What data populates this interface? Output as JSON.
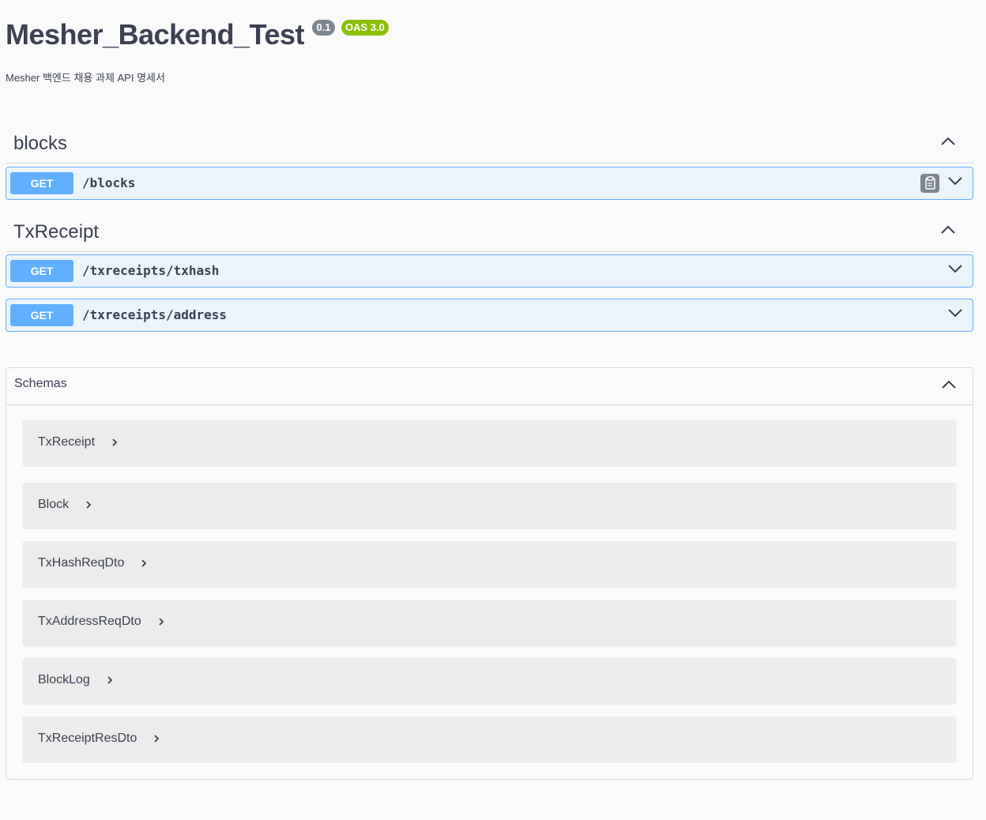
{
  "info": {
    "title": "Mesher_Backend_Test",
    "version": "0.1",
    "oas": "OAS 3.0",
    "description": "Mesher 백엔드 채용 과제 API 명세서"
  },
  "tags": [
    {
      "name": "blocks",
      "operations": [
        {
          "method": "GET",
          "path": "/blocks"
        }
      ]
    },
    {
      "name": "TxReceipt",
      "operations": [
        {
          "method": "GET",
          "path": "/txreceipts/txhash"
        },
        {
          "method": "GET",
          "path": "/txreceipts/address"
        }
      ]
    }
  ],
  "schemas": {
    "label": "Schemas",
    "models": [
      "TxReceipt",
      "Block",
      "TxHashReqDto",
      "TxAddressReqDto",
      "BlockLog",
      "TxReceiptResDto"
    ]
  },
  "colors": {
    "get_method": "#61affe",
    "get_background": "#ebf3fb",
    "oas_badge": "#89bf04",
    "version_badge": "#7d8492"
  },
  "icons": [
    "chevron-up-icon",
    "chevron-down-icon",
    "chevron-right-icon",
    "copy-icon"
  ]
}
